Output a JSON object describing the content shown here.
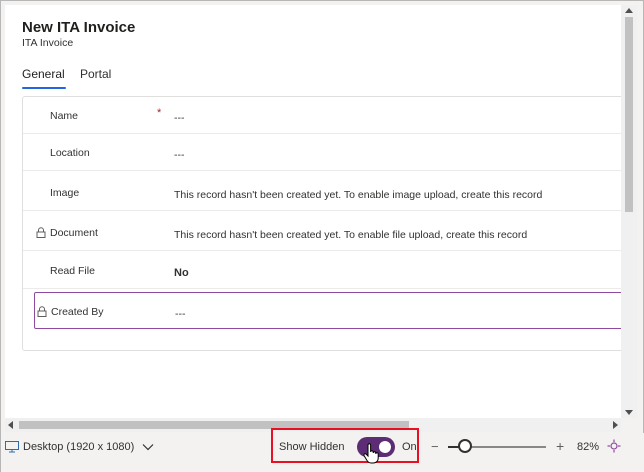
{
  "form": {
    "title": "New ITA Invoice",
    "subtitle": "ITA Invoice",
    "tabs": [
      {
        "label": "General",
        "active": true
      },
      {
        "label": "Portal",
        "active": false
      }
    ],
    "fields": [
      {
        "label": "Name",
        "value": "---",
        "required": "*",
        "locked": false
      },
      {
        "label": "Location",
        "value": "---",
        "locked": false
      },
      {
        "label": "Image",
        "value": "This record hasn't been created yet. To enable image upload, create this record",
        "locked": false
      },
      {
        "label": "Document",
        "value": "This record hasn't been created yet. To enable file upload, create this record",
        "locked": true
      },
      {
        "label": "Read File",
        "value": "No",
        "locked": false
      },
      {
        "label": "Created By",
        "value": "---",
        "locked": true
      }
    ]
  },
  "statusbar": {
    "device_label": "Desktop (1920 x 1080)",
    "show_hidden_label": "Show Hidden",
    "toggle_state": "On",
    "toggle_on": true,
    "zoom_minus": "−",
    "zoom_plus": "+",
    "zoom_level": "82%",
    "zoom_fraction": 0.17
  },
  "colors": {
    "accent_blue": "#2266e3",
    "toggle_purple": "#5c2d74",
    "selection_border": "#8e4aa0",
    "required_red": "#a4262c",
    "highlight_red": "#e81123"
  },
  "icons": {
    "lock": "lock-icon",
    "monitor": "monitor-icon",
    "chevron": "chevron-down-icon",
    "fit": "fit-to-screen-icon",
    "cursor": "hand-cursor-icon"
  }
}
